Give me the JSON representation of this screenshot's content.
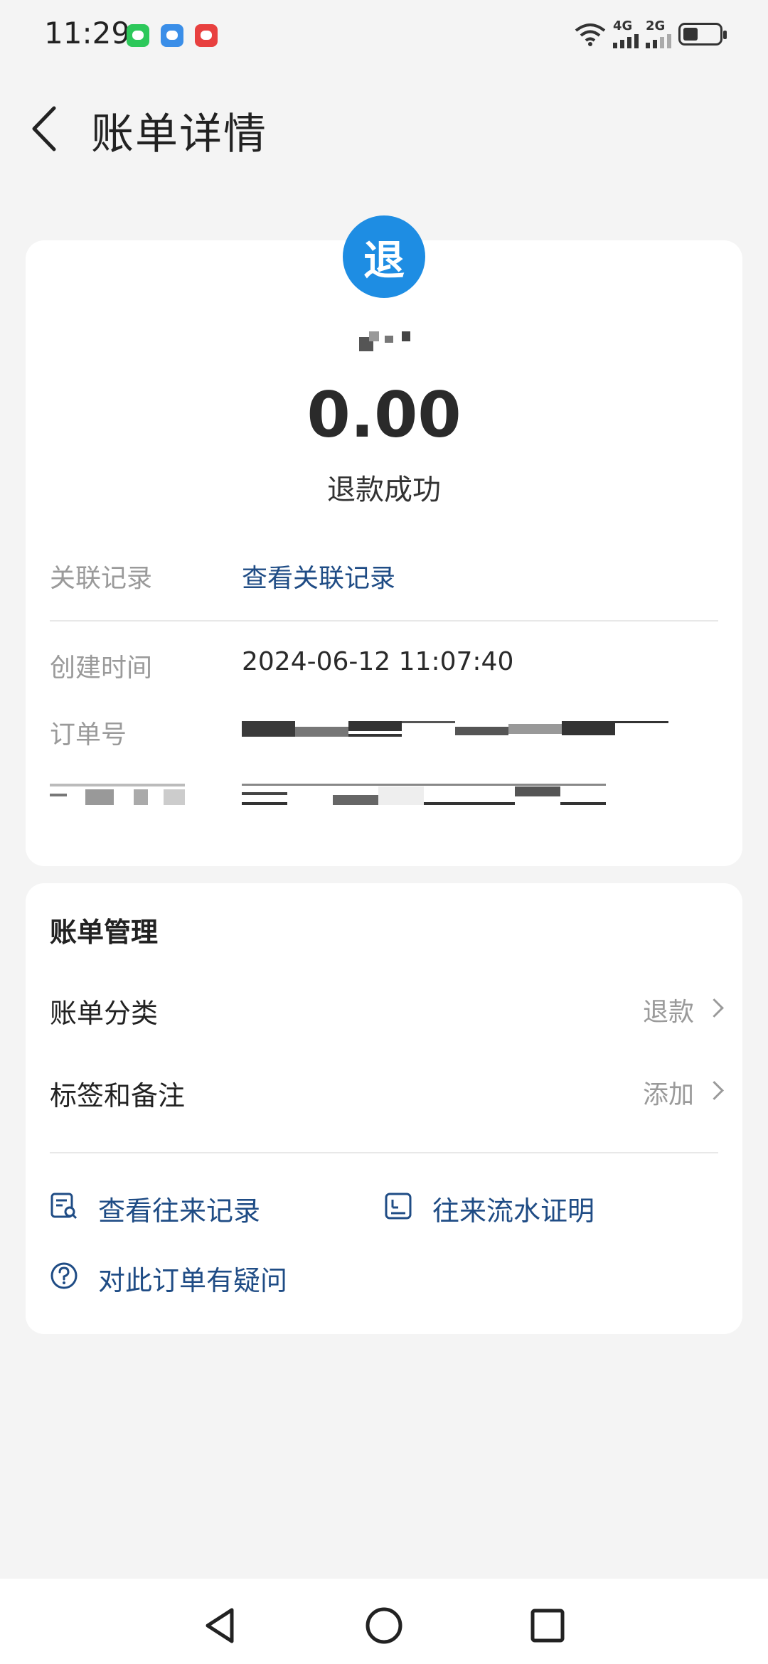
{
  "status_bar": {
    "time": "11:29",
    "network_1": "4G",
    "network_2": "2G",
    "icons": [
      "wechat-icon",
      "weather-icon",
      "red-app-icon",
      "wifi-icon",
      "signal-icon",
      "battery-icon"
    ]
  },
  "header": {
    "title": "账单详情"
  },
  "summary": {
    "badge_char": "退",
    "amount": "0.00",
    "status": "退款成功",
    "badge_color": "#1e8de3"
  },
  "details": {
    "related_label": "关联记录",
    "related_link": "查看关联记录",
    "created_label": "创建时间",
    "created_value": "2024-06-12 11:07:40",
    "order_label": "订单号"
  },
  "management": {
    "title": "账单管理",
    "category_label": "账单分类",
    "category_value": "退款",
    "tags_label": "标签和备注",
    "tags_value": "添加"
  },
  "actions": {
    "view_history": "查看往来记录",
    "statement": "往来流水证明",
    "question": "对此订单有疑问"
  },
  "colors": {
    "accent_link": "#1f4c85",
    "background": "#f4f4f4"
  }
}
